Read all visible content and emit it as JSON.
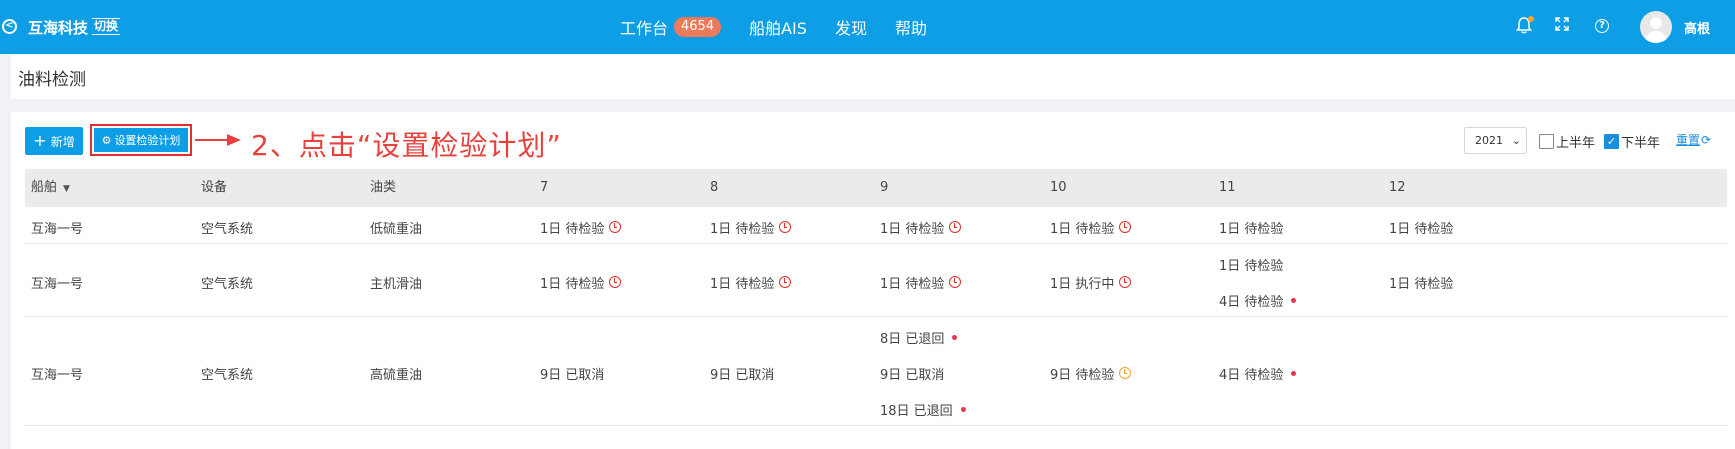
{
  "topbar": {
    "brand": "互海科技",
    "switch_label": "切换",
    "nav": [
      {
        "label": "工作台",
        "badge": "4654"
      },
      {
        "label": "船舶AIS"
      },
      {
        "label": "发现"
      },
      {
        "label": "帮助"
      }
    ],
    "user_name": "高根"
  },
  "page": {
    "title": "油料检测"
  },
  "toolbar": {
    "new_label": "新增",
    "plan_label": "设置检验计划",
    "annotation": "2、点击“设置检验计划”",
    "year": "2021",
    "first_half_label": "上半年",
    "second_half_label": "下半年",
    "first_half_checked": false,
    "second_half_checked": true,
    "reset_label": "重置"
  },
  "table": {
    "headers": {
      "ship": "船舶",
      "equipment": "设备",
      "oil": "油类",
      "months": [
        "7",
        "8",
        "9",
        "10",
        "11",
        "12"
      ]
    },
    "rows": [
      {
        "ship": "互海一号",
        "equipment": "空气系统",
        "oil": "低硫重油",
        "months": [
          [
            {
              "text": "1日 待检验",
              "mark": "clock-red"
            }
          ],
          [
            {
              "text": "1日 待检验",
              "mark": "clock-red"
            }
          ],
          [
            {
              "text": "1日 待检验",
              "mark": "clock-red"
            }
          ],
          [
            {
              "text": "1日 待检验",
              "mark": "clock-red"
            }
          ],
          [
            {
              "text": "1日 待检验",
              "mark": ""
            }
          ],
          [
            {
              "text": "1日 待检验",
              "mark": ""
            }
          ]
        ]
      },
      {
        "ship": "互海一号",
        "equipment": "空气系统",
        "oil": "主机滑油",
        "months": [
          [
            {
              "text": "1日 待检验",
              "mark": "clock-red"
            }
          ],
          [
            {
              "text": "1日 待检验",
              "mark": "clock-red"
            }
          ],
          [
            {
              "text": "1日 待检验",
              "mark": "clock-red"
            }
          ],
          [
            {
              "text": "1日 执行中",
              "mark": "clock-red"
            }
          ],
          [
            {
              "text": "1日 待检验",
              "mark": ""
            },
            {
              "text": "4日 待检验",
              "mark": "dot"
            }
          ],
          [
            {
              "text": "1日 待检验",
              "mark": ""
            }
          ]
        ]
      },
      {
        "ship": "互海一号",
        "equipment": "空气系统",
        "oil": "高硫重油",
        "months": [
          [
            {
              "text": "9日 已取消",
              "mark": ""
            }
          ],
          [
            {
              "text": "9日 已取消",
              "mark": ""
            }
          ],
          [
            {
              "text": "8日 已退回",
              "mark": "dot"
            },
            {
              "text": "9日 已取消",
              "mark": ""
            },
            {
              "text": "18日 已退回",
              "mark": "dot"
            }
          ],
          [
            {
              "text": "9日 待检验",
              "mark": "clock-orange"
            }
          ],
          [
            {
              "text": "4日 待检验",
              "mark": "dot"
            }
          ],
          []
        ]
      }
    ]
  }
}
